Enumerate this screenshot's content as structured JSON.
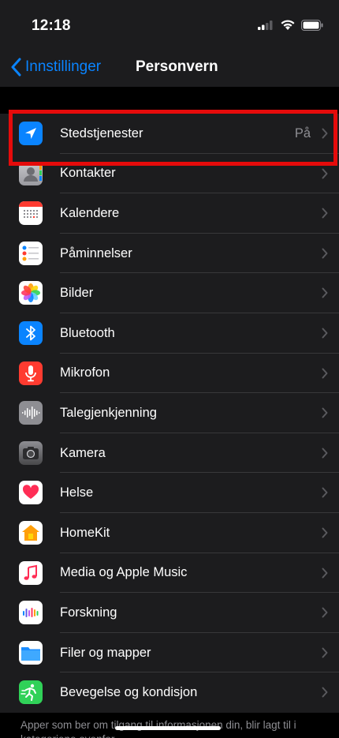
{
  "status_bar": {
    "time": "12:18"
  },
  "nav": {
    "back_label": "Innstillinger",
    "title": "Personvern"
  },
  "rows": [
    {
      "label": "Stedstjenester",
      "value": "På",
      "icon": "location-arrow-icon",
      "color": "#0a84ff"
    },
    {
      "label": "Kontakter",
      "value": "",
      "icon": "contacts-icon",
      "color": "#a3a3a8"
    },
    {
      "label": "Kalendere",
      "value": "",
      "icon": "calendar-icon",
      "color": "#ffffff"
    },
    {
      "label": "Påminnelser",
      "value": "",
      "icon": "reminders-icon",
      "color": "#ffffff"
    },
    {
      "label": "Bilder",
      "value": "",
      "icon": "photos-icon",
      "color": "#ffffff"
    },
    {
      "label": "Bluetooth",
      "value": "",
      "icon": "bluetooth-icon",
      "color": "#0a84ff"
    },
    {
      "label": "Mikrofon",
      "value": "",
      "icon": "microphone-icon",
      "color": "#ff3b30"
    },
    {
      "label": "Talegjenkjenning",
      "value": "",
      "icon": "speech-recognition-icon",
      "color": "#8e8e93"
    },
    {
      "label": "Kamera",
      "value": "",
      "icon": "camera-icon",
      "color": "#636366"
    },
    {
      "label": "Helse",
      "value": "",
      "icon": "health-heart-icon",
      "color": "#ffffff"
    },
    {
      "label": "HomeKit",
      "value": "",
      "icon": "homekit-icon",
      "color": "#ff9f0a"
    },
    {
      "label": "Media og Apple Music",
      "value": "",
      "icon": "music-icon",
      "color": "#ff2d55"
    },
    {
      "label": "Forskning",
      "value": "",
      "icon": "research-icon",
      "color": "#ffffff"
    },
    {
      "label": "Filer og mapper",
      "value": "",
      "icon": "folder-icon",
      "color": "#1a8cff"
    },
    {
      "label": "Bevegelse og kondisjon",
      "value": "",
      "icon": "motion-fitness-icon",
      "color": "#30d158"
    }
  ],
  "footer": {
    "text": "Apper som ber om tilgang til informasjonen din, blir lagt til i kategoriene ovenfor."
  },
  "colors": {
    "accent": "#0a84ff",
    "highlight": "#e50b0b"
  }
}
